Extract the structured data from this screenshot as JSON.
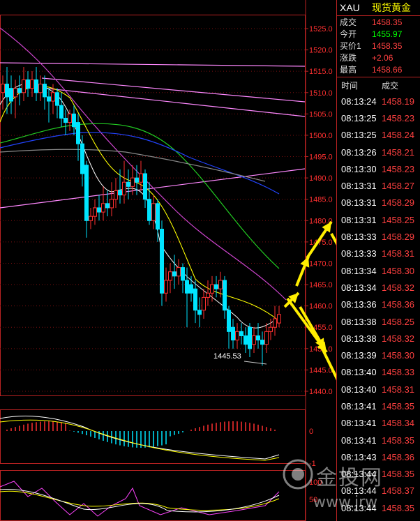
{
  "chart": {
    "price_axis": [
      "1525.0",
      "1520.0",
      "1515.0",
      "1510.0",
      "1505.0",
      "1500.0",
      "1495.0",
      "1490.0",
      "1485.0",
      "1480.0",
      "1475.0",
      "1470.0",
      "1465.0",
      "1460.0",
      "1455.0",
      "1450.0",
      "1445.0",
      "1440.0"
    ],
    "low_label": "1445.53",
    "macd_axis_label": "0",
    "kdj_axis_labels": [
      "100",
      "50"
    ],
    "macd_bottom_label": "-1",
    "colors": {
      "up": "#ff3030",
      "down": "#00e5ff",
      "ma5": "#ffffff",
      "ma10": "#ffff00",
      "ma20": "#ff00ff",
      "ma30": "#00ff00",
      "ma60": "#3060ff",
      "ma120": "#999999",
      "arrow": "#ffee00"
    }
  },
  "quote": {
    "symbol": "XAU",
    "name": "现货黄金",
    "rows": [
      {
        "label": "成交",
        "value": "1458.35",
        "color": "red"
      },
      {
        "label": "今开",
        "value": "1455.97",
        "color": "green"
      },
      {
        "label": "买价1",
        "value": "1458.35",
        "color": "red"
      },
      {
        "label": "涨跌",
        "value": "+2.06",
        "color": "red"
      },
      {
        "label": "最高",
        "value": "1458.66",
        "color": "red"
      }
    ],
    "ticks_header": {
      "time": "时间",
      "price": "成交"
    },
    "ticks": [
      {
        "time": "08:13:24",
        "price": "1458.19"
      },
      {
        "time": "08:13:25",
        "price": "1458.23"
      },
      {
        "time": "08:13:25",
        "price": "1458.24"
      },
      {
        "time": "08:13:26",
        "price": "1458.21"
      },
      {
        "time": "08:13:30",
        "price": "1458.23"
      },
      {
        "time": "08:13:31",
        "price": "1458.27"
      },
      {
        "time": "08:13:31",
        "price": "1458.29"
      },
      {
        "time": "08:13:31",
        "price": "1458.25"
      },
      {
        "time": "08:13:33",
        "price": "1458.29"
      },
      {
        "time": "08:13:33",
        "price": "1458.31"
      },
      {
        "time": "08:13:34",
        "price": "1458.30"
      },
      {
        "time": "08:13:34",
        "price": "1458.32"
      },
      {
        "time": "08:13:36",
        "price": "1458.36"
      },
      {
        "time": "08:13:38",
        "price": "1458.25"
      },
      {
        "time": "08:13:38",
        "price": "1458.32"
      },
      {
        "time": "08:13:39",
        "price": "1458.30"
      },
      {
        "time": "08:13:40",
        "price": "1458.33"
      },
      {
        "time": "08:13:40",
        "price": "1458.31"
      },
      {
        "time": "08:13:41",
        "price": "1458.35"
      },
      {
        "time": "08:13:41",
        "price": "1458.34"
      },
      {
        "time": "08:13:41",
        "price": "1458.35"
      },
      {
        "time": "08:13:43",
        "price": "1458.36"
      },
      {
        "time": "08:13:44",
        "price": "1458.35"
      },
      {
        "time": "08:13:44",
        "price": "1458.37"
      },
      {
        "time": "08:13:44",
        "price": "1458.35"
      }
    ]
  },
  "watermark": {
    "cn": "金投网",
    "url": "www.jrw"
  }
}
